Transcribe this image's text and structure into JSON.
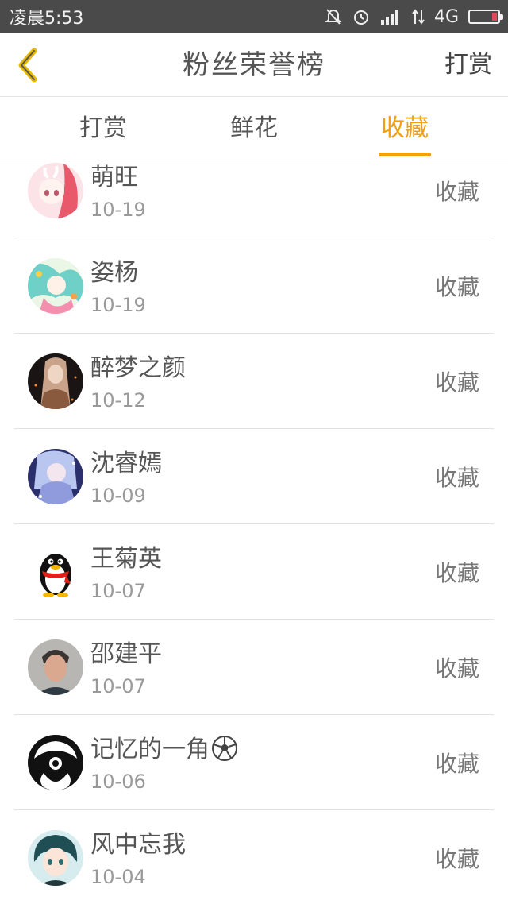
{
  "status_bar": {
    "time": "凌晨5:53",
    "network": "4G"
  },
  "header": {
    "title": "粉丝荣誉榜",
    "action": "打赏"
  },
  "tabs": [
    {
      "label": "打赏"
    },
    {
      "label": "鲜花"
    },
    {
      "label": "收藏",
      "active": true
    }
  ],
  "colors": {
    "accent": "#f2a011",
    "status_bar": "#4a4a4a"
  },
  "fans": [
    {
      "name": "萌旺",
      "date": "10-19",
      "action": "收藏",
      "avatar": "anime-pink-icon"
    },
    {
      "name": "姿杨",
      "date": "10-19",
      "action": "收藏",
      "avatar": "anime-teal-icon"
    },
    {
      "name": "醉梦之颜",
      "date": "10-12",
      "action": "收藏",
      "avatar": "dark-portrait-icon"
    },
    {
      "name": "沈睿嫣",
      "date": "10-09",
      "action": "收藏",
      "avatar": "anime-blue-icon"
    },
    {
      "name": "王菊英",
      "date": "10-07",
      "action": "收藏",
      "avatar": "penguin-icon"
    },
    {
      "name": "邵建平",
      "date": "10-07",
      "action": "收藏",
      "avatar": "photo-portrait-icon"
    },
    {
      "name": "记忆的一角",
      "date": "10-06",
      "action": "收藏",
      "avatar": "bw-logo-icon",
      "emoji": "soccer-ball-icon"
    },
    {
      "name": "风中忘我",
      "date": "10-04",
      "action": "收藏",
      "avatar": "anime-boy-icon"
    }
  ]
}
